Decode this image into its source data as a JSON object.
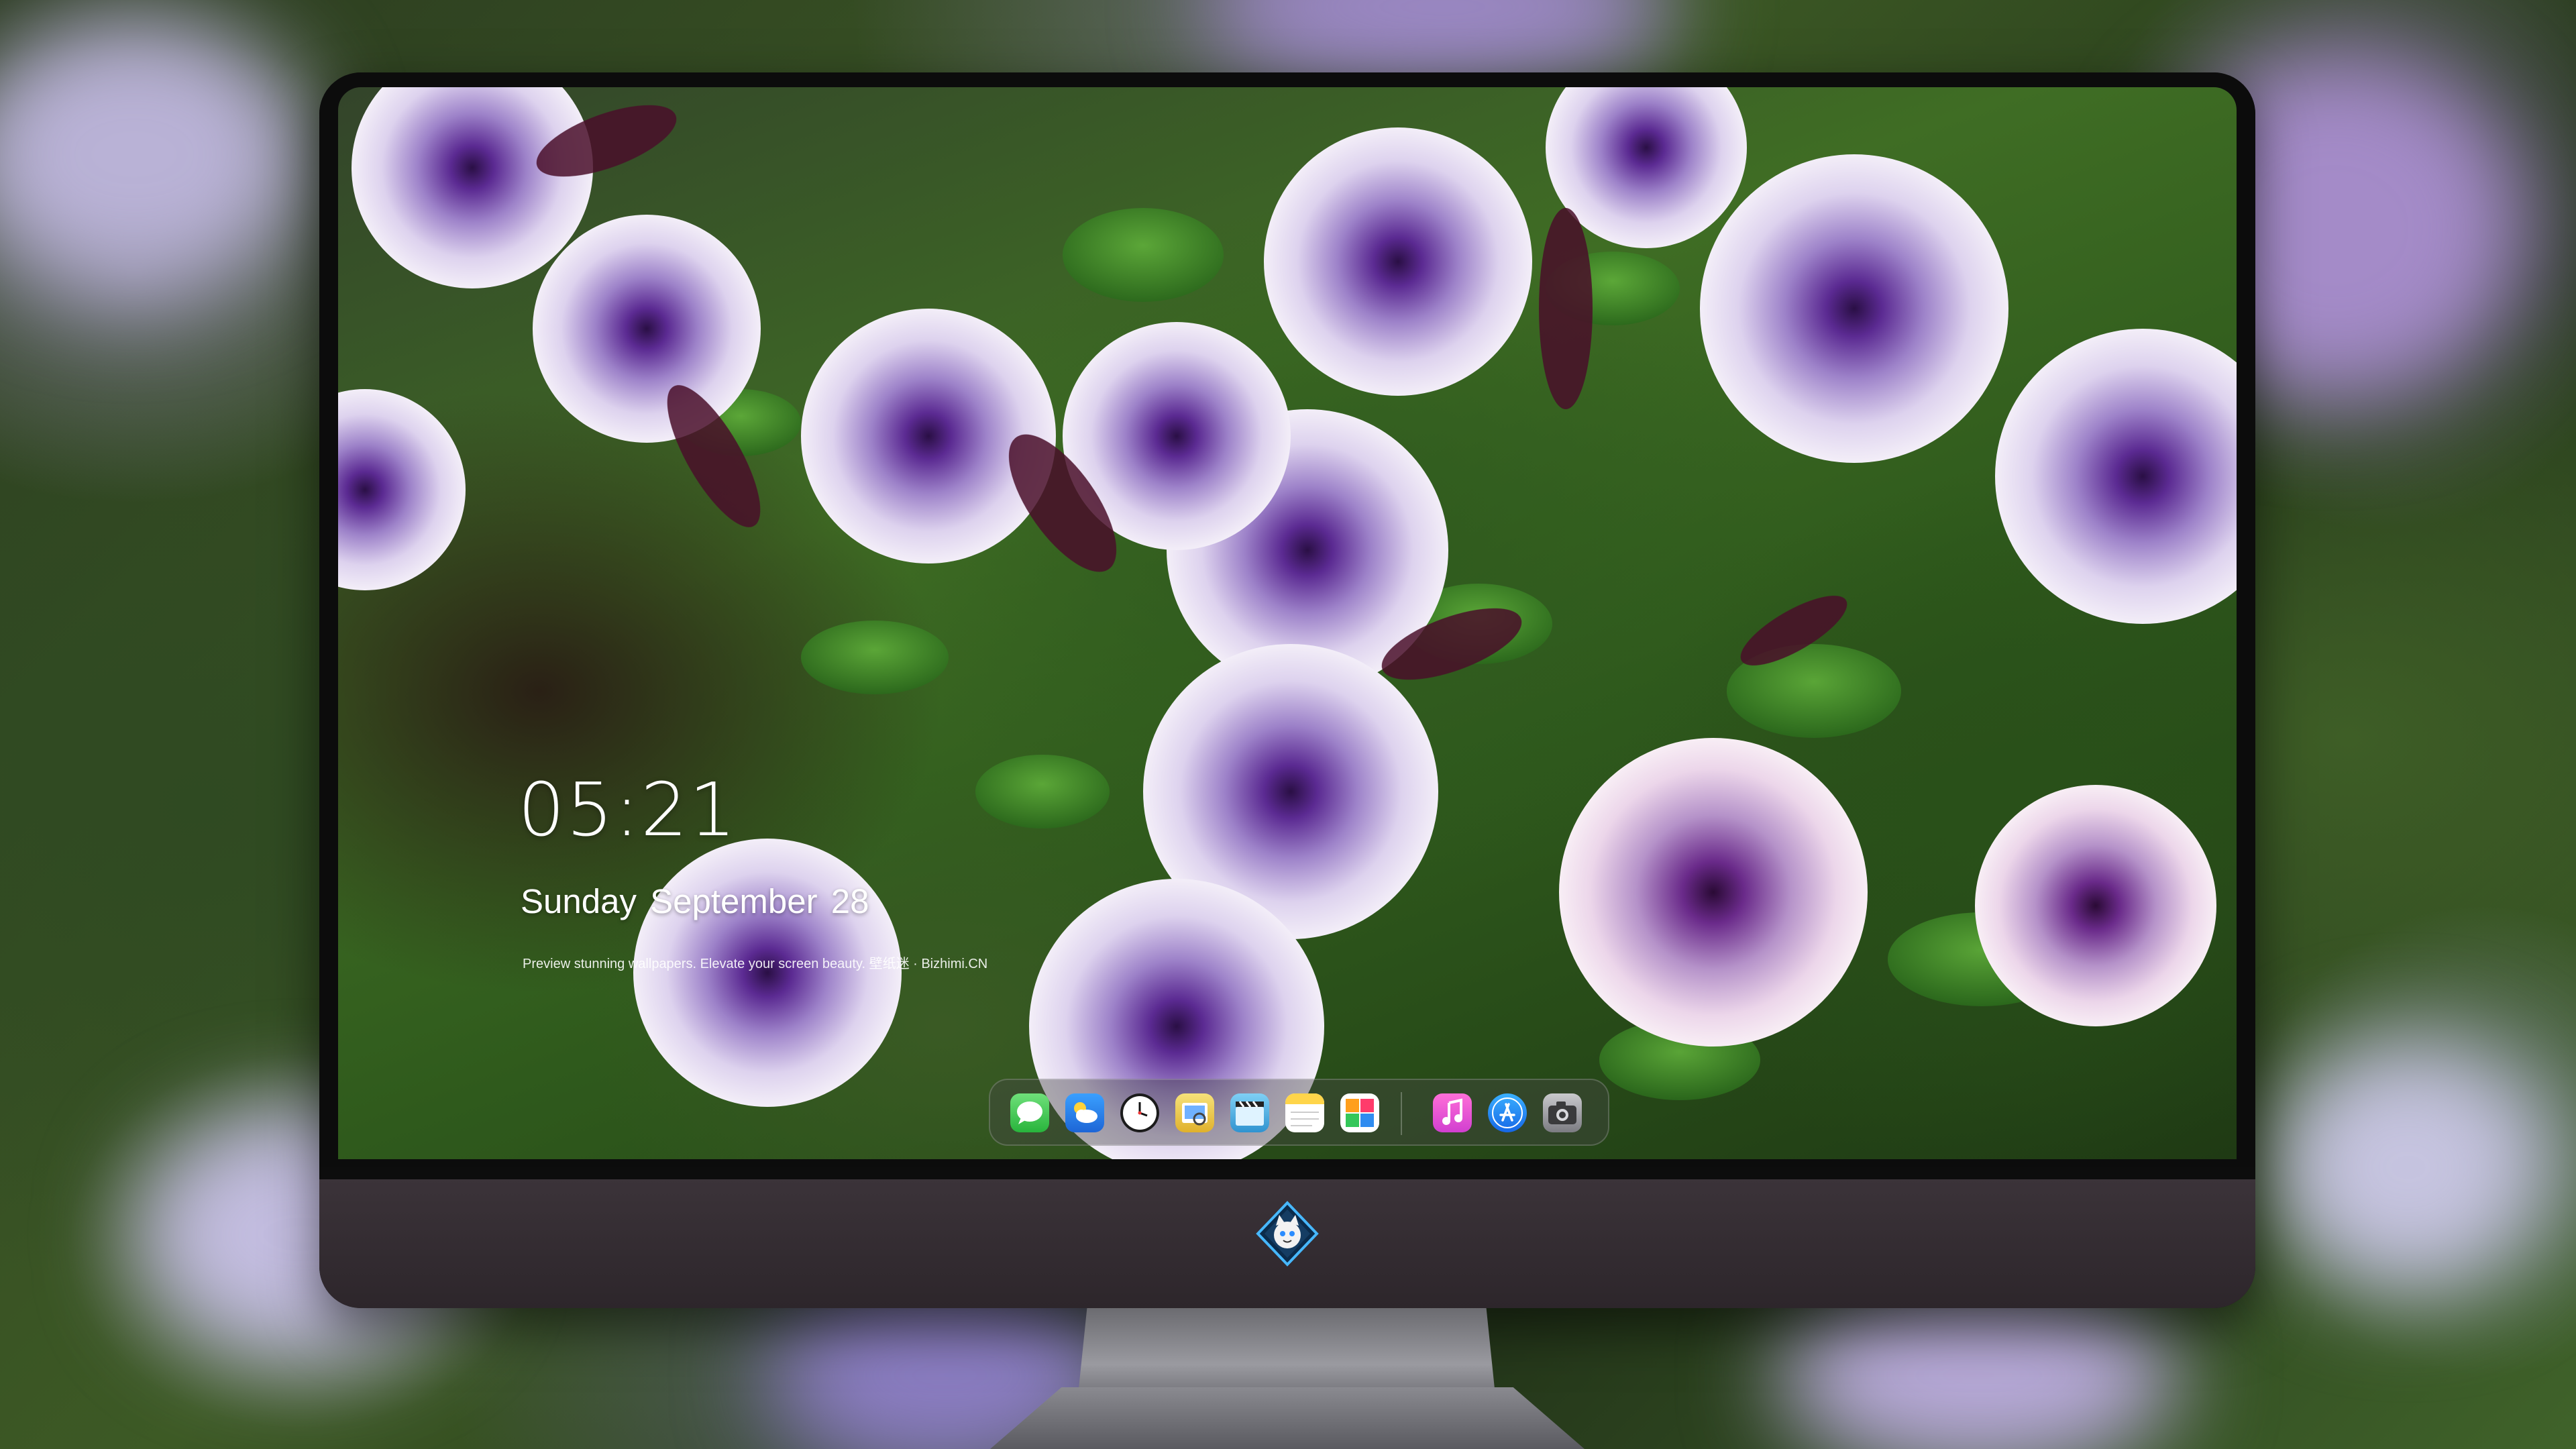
{
  "lock_screen": {
    "time": "05:21",
    "date": "Sunday September  28",
    "tagline": "Preview stunning wallpapers. Elevate your screen beauty. 壁纸迷 · Bizhimi.CN"
  },
  "dock": {
    "apps": [
      {
        "name": "messages-icon",
        "color": "#34c759"
      },
      {
        "name": "weather-icon",
        "color": "#2f8cf0"
      },
      {
        "name": "clock-icon",
        "color": "#ffffff"
      },
      {
        "name": "preview-icon",
        "color": "#f2c94c"
      },
      {
        "name": "final-cut-icon",
        "color": "#4fb3e8"
      },
      {
        "name": "notes-icon",
        "color": "#ffd54a"
      },
      {
        "name": "photos-icon",
        "color": "#ff9f1c"
      },
      {
        "name": "music-icon",
        "color": "#fa4fd6"
      },
      {
        "name": "app-store-icon",
        "color": "#1e90ff"
      },
      {
        "name": "camera-icon",
        "color": "#8e8e93"
      }
    ]
  },
  "colors": {
    "petal": "#e6dcf2",
    "petal_vein": "#4a1f7a",
    "bezel": "#0c0c0c",
    "chin": "#332b31"
  }
}
